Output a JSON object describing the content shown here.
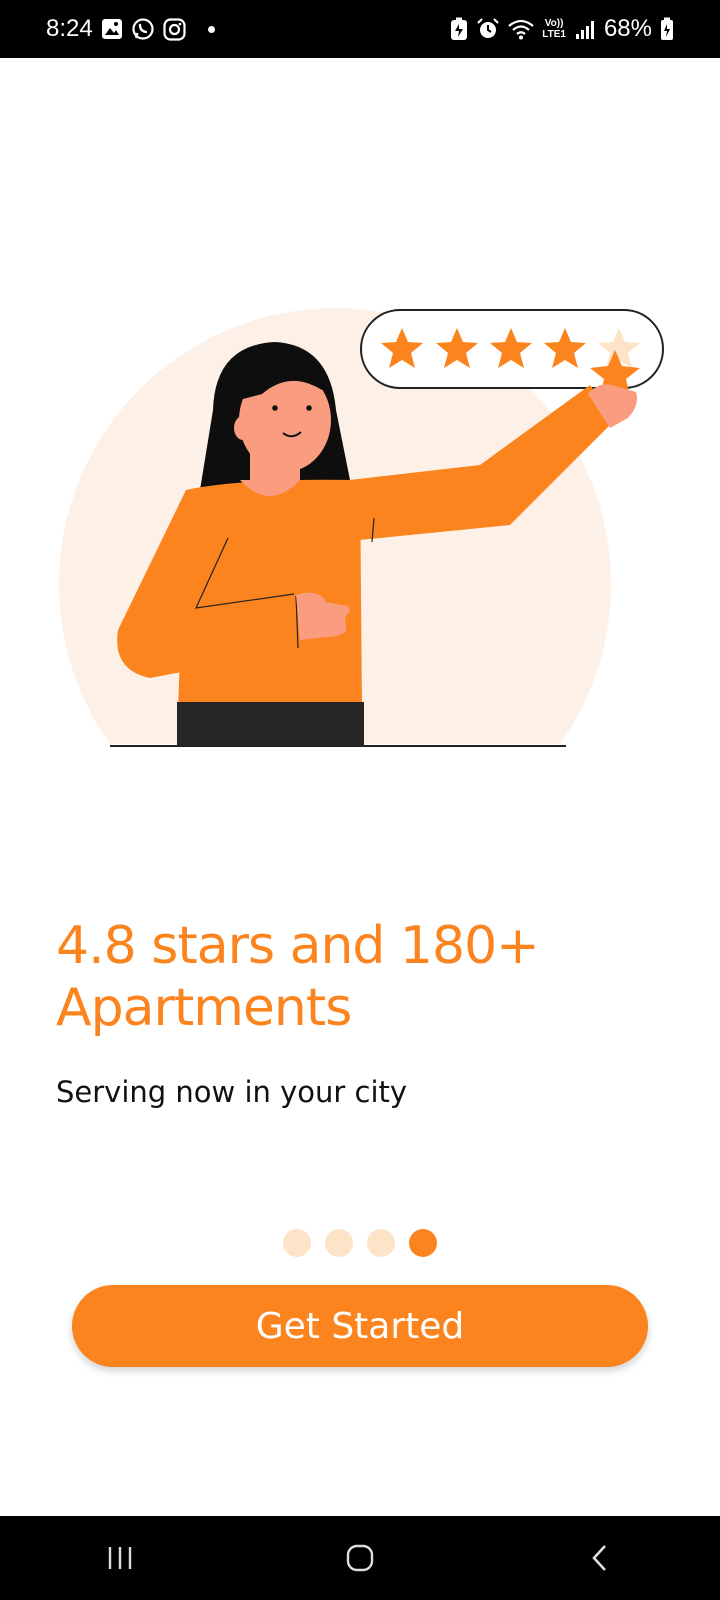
{
  "status_bar": {
    "time": "8:24",
    "left_icons": [
      "gallery-icon",
      "whatsapp-icon",
      "instagram-icon",
      "notification-dot"
    ],
    "right_icons": [
      "battery-saver-icon",
      "alarm-icon",
      "wifi-icon",
      "volte-icon",
      "signal-icon"
    ],
    "volte_label": "Vo))",
    "lte_label": "LTE1",
    "battery": "68%"
  },
  "illustration": {
    "description_icon": "woman-rating-stars-illustration",
    "stars_filled": 4,
    "stars_total": 5
  },
  "onboarding": {
    "headline": "4.8 stars and 180+ Apartments",
    "subline": "Serving now in your city",
    "page_count": 4,
    "current_page": 4
  },
  "cta": {
    "label": "Get Started"
  },
  "nav_bar": {
    "icons": [
      "recents-icon",
      "home-icon",
      "back-icon"
    ]
  },
  "colors": {
    "accent": "#FB841E",
    "accent_light": "#FDE3C7",
    "illustration_bg": "#FDF0E7"
  }
}
